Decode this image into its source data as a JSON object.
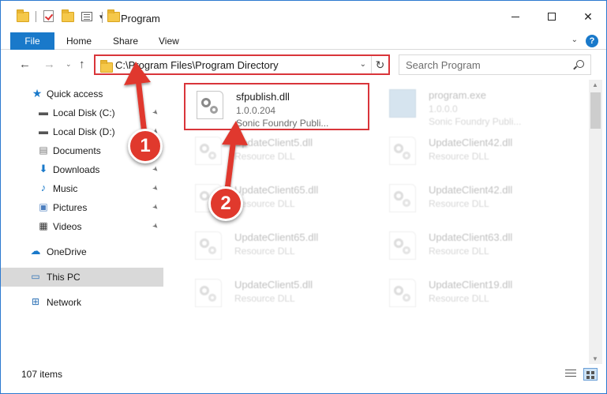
{
  "window": {
    "title": "Program",
    "qat_dropdown": "▾",
    "minimize": "",
    "maximize": "",
    "close": "✕"
  },
  "ribbon": {
    "tabs": [
      "File",
      "Home",
      "Share",
      "View"
    ],
    "collapse": "⌄",
    "help": "?"
  },
  "nav": {
    "back": "←",
    "forward": "→",
    "recent": "⌄",
    "up": "↑"
  },
  "address": {
    "path": "C:\\Program Files\\Program Directory",
    "dropdown": "⌄",
    "refresh": "↻"
  },
  "search": {
    "placeholder": "Search Program"
  },
  "sidebar": {
    "items": [
      {
        "label": "Quick access",
        "icon": "star-icon",
        "pinned": false,
        "selected": false
      },
      {
        "label": "Local Disk (C:)",
        "icon": "drive-icon",
        "pinned": true,
        "selected": false
      },
      {
        "label": "Local Disk (D:)",
        "icon": "drive-icon",
        "pinned": true,
        "selected": false
      },
      {
        "label": "Documents",
        "icon": "documents-icon",
        "pinned": true,
        "selected": false
      },
      {
        "label": "Downloads",
        "icon": "download-icon",
        "pinned": true,
        "selected": false
      },
      {
        "label": "Music",
        "icon": "music-icon",
        "pinned": true,
        "selected": false
      },
      {
        "label": "Pictures",
        "icon": "pictures-icon",
        "pinned": true,
        "selected": false
      },
      {
        "label": "Videos",
        "icon": "videos-icon",
        "pinned": true,
        "selected": false
      },
      {
        "label": "OneDrive",
        "icon": "cloud-icon",
        "pinned": false,
        "selected": false
      },
      {
        "label": "This PC",
        "icon": "computer-icon",
        "pinned": false,
        "selected": true
      },
      {
        "label": "Network",
        "icon": "network-icon",
        "pinned": false,
        "selected": false
      }
    ],
    "pin_glyph": "📌"
  },
  "files": [
    {
      "name": "sfpublish.dll",
      "line2": "1.0.0.204",
      "line3": "Sonic Foundry Publi...",
      "type": "dll",
      "selected": true,
      "faded": false
    },
    {
      "name": "program.exe",
      "line2": "1.0.0.0",
      "line3": "Sonic Foundry Publi...",
      "type": "exe",
      "selected": false,
      "faded": true
    },
    {
      "name": "UpdateClient5.dll",
      "line2": "Resource DLL",
      "line3": "",
      "type": "dll",
      "selected": false,
      "faded": true
    },
    {
      "name": "UpdateClient42.dll",
      "line2": "Resource DLL",
      "line3": "",
      "type": "dll",
      "selected": false,
      "faded": true
    },
    {
      "name": "UpdateClient65.dll",
      "line2": "Resource DLL",
      "line3": "",
      "type": "dll",
      "selected": false,
      "faded": true
    },
    {
      "name": "UpdateClient42.dll",
      "line2": "Resource DLL",
      "line3": "",
      "type": "dll",
      "selected": false,
      "faded": true
    },
    {
      "name": "UpdateClient65.dll",
      "line2": "Resource DLL",
      "line3": "",
      "type": "dll",
      "selected": false,
      "faded": true
    },
    {
      "name": "UpdateClient63.dll",
      "line2": "Resource DLL",
      "line3": "",
      "type": "dll",
      "selected": false,
      "faded": true
    },
    {
      "name": "UpdateClient5.dll",
      "line2": "Resource DLL",
      "line3": "",
      "type": "dll",
      "selected": false,
      "faded": true
    },
    {
      "name": "UpdateClient19.dll",
      "line2": "Resource DLL",
      "line3": "",
      "type": "dll",
      "selected": false,
      "faded": true
    }
  ],
  "status": {
    "item_count": "107 items"
  },
  "annotations": {
    "callout_1": "1",
    "callout_2": "2",
    "color": "#e0392d"
  },
  "colors": {
    "accent": "#1979ca",
    "highlight": "#d9353a",
    "selected_nav": "#d9d9d9"
  }
}
